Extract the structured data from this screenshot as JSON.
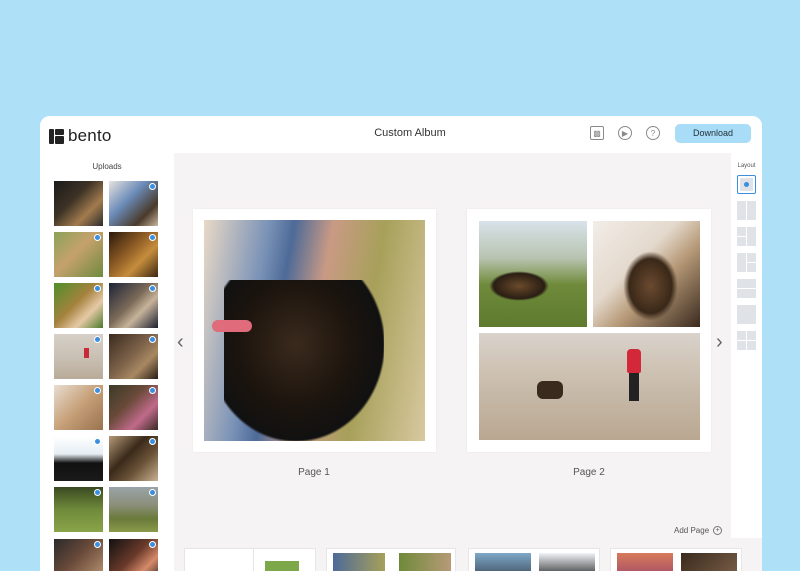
{
  "app": {
    "logo": "bento",
    "title": "Custom Album",
    "download_label": "Download"
  },
  "header_icons": [
    "save-icon",
    "play-icon",
    "help-icon"
  ],
  "uploads": {
    "title": "Uploads",
    "count": 16
  },
  "pages": [
    {
      "label": "Page 1"
    },
    {
      "label": "Page 2"
    }
  ],
  "layout": {
    "title": "Layout",
    "options": [
      "layout-single",
      "layout-two-column",
      "layout-three-split",
      "layout-four-mixed",
      "layout-two-row",
      "layout-full",
      "layout-grid"
    ]
  },
  "filmstrip": {
    "add_page_label": "Add Page"
  },
  "colors": {
    "accent": "#a9dcf6",
    "background": "#aee0f7",
    "check": "#3a8fe0"
  }
}
